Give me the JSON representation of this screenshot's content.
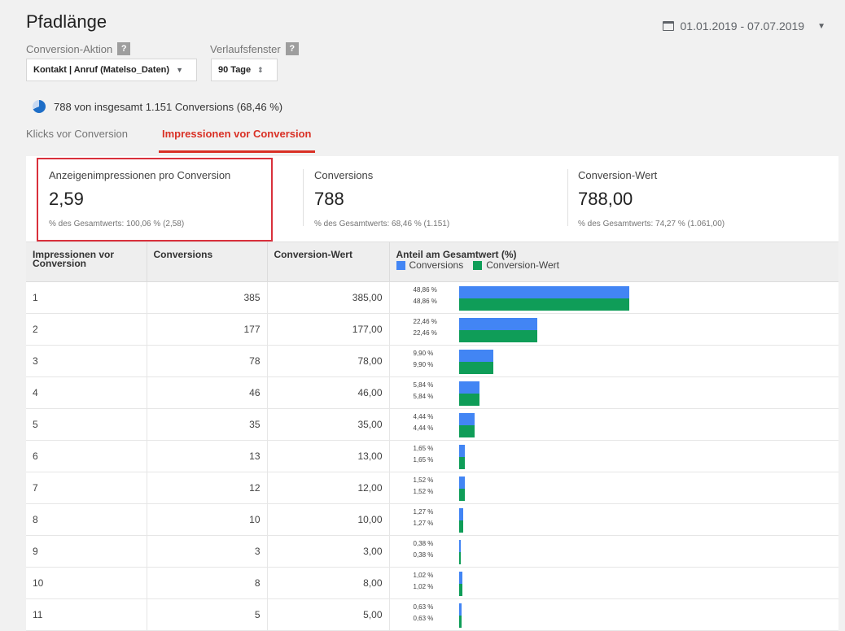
{
  "page": {
    "title": "Pfadlänge",
    "date_range": "01.01.2019 - 07.07.2019",
    "conversion_action_label": "Conversion-Aktion",
    "conversion_action_value": "Kontakt | Anruf (Matelso_Daten)",
    "window_label": "Verlaufsfenster",
    "window_value": "90 Tage",
    "help_glyph": "?",
    "summary": "788 von insgesamt 1.151 Conversions (68,46 %)"
  },
  "tabs": [
    {
      "label": "Klicks vor Conversion",
      "active": false
    },
    {
      "label": "Impressionen vor Conversion",
      "active": true
    }
  ],
  "stats": [
    {
      "label": "Anzeigenimpressionen pro Conversion",
      "value": "2,59",
      "sub": "% des Gesamtwerts: 100,06 % (2,58)"
    },
    {
      "label": "Conversions",
      "value": "788",
      "sub": "% des Gesamtwerts: 68,46 % (1.151)"
    },
    {
      "label": "Conversion-Wert",
      "value": "788,00",
      "sub": "% des Gesamtwerts: 74,27 % (1.061,00)"
    }
  ],
  "table": {
    "headers": [
      "Impressionen vor Conversion",
      "Conversions",
      "Conversion-Wert",
      "Anteil am Gesamtwert (%)"
    ],
    "legend": [
      "Conversions",
      "Conversion-Wert"
    ],
    "colors": {
      "conversions": "#4285f4",
      "value": "#0f9d58"
    },
    "rows": [
      {
        "k": "1",
        "conv": "385",
        "val": "385,00",
        "pct_conv": "48,86 %",
        "pct_val": "48,86 %",
        "share": 48.86
      },
      {
        "k": "2",
        "conv": "177",
        "val": "177,00",
        "pct_conv": "22,46 %",
        "pct_val": "22,46 %",
        "share": 22.46
      },
      {
        "k": "3",
        "conv": "78",
        "val": "78,00",
        "pct_conv": "9,90 %",
        "pct_val": "9,90 %",
        "share": 9.9
      },
      {
        "k": "4",
        "conv": "46",
        "val": "46,00",
        "pct_conv": "5,84 %",
        "pct_val": "5,84 %",
        "share": 5.84
      },
      {
        "k": "5",
        "conv": "35",
        "val": "35,00",
        "pct_conv": "4,44 %",
        "pct_val": "4,44 %",
        "share": 4.44
      },
      {
        "k": "6",
        "conv": "13",
        "val": "13,00",
        "pct_conv": "1,65 %",
        "pct_val": "1,65 %",
        "share": 1.65
      },
      {
        "k": "7",
        "conv": "12",
        "val": "12,00",
        "pct_conv": "1,52 %",
        "pct_val": "1,52 %",
        "share": 1.52
      },
      {
        "k": "8",
        "conv": "10",
        "val": "10,00",
        "pct_conv": "1,27 %",
        "pct_val": "1,27 %",
        "share": 1.27
      },
      {
        "k": "9",
        "conv": "3",
        "val": "3,00",
        "pct_conv": "0,38 %",
        "pct_val": "0,38 %",
        "share": 0.38
      },
      {
        "k": "10",
        "conv": "8",
        "val": "8,00",
        "pct_conv": "1,02 %",
        "pct_val": "1,02 %",
        "share": 1.02
      },
      {
        "k": "11",
        "conv": "5",
        "val": "5,00",
        "pct_conv": "0,63 %",
        "pct_val": "0,63 %",
        "share": 0.63
      }
    ]
  }
}
